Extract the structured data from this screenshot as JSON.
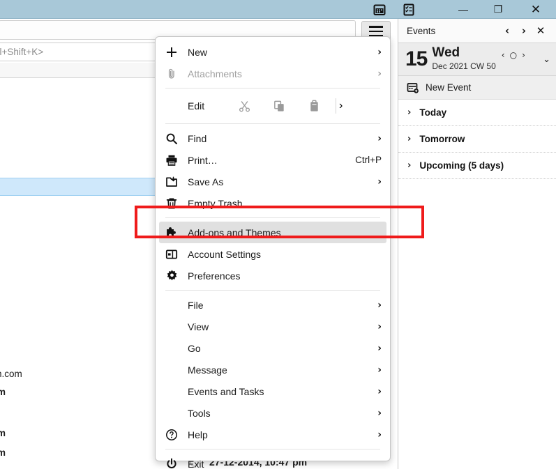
{
  "titlebar": {
    "tabs": [
      {
        "name": "calendar-tab",
        "icon": "calendar-icon"
      },
      {
        "name": "tasks-tab",
        "icon": "tasks-icon"
      }
    ],
    "window_controls": {
      "minimize": "—",
      "restore": "❐",
      "close": "✕"
    },
    "color": "#a8c8d8"
  },
  "mail_pane": {
    "quick_filter_placeholder": "rl+Shift+K>",
    "visible_texts": [
      {
        "text": "@paytm.com",
        "bold": false
      },
      {
        "text": "m",
        "bold": true
      },
      {
        "text": "m",
        "bold": true
      },
      {
        "text": "m",
        "bold": true
      }
    ],
    "ghost_row_text": "27-12-2014, 10:47 pm"
  },
  "hamburger": {
    "name": "app-menu-button",
    "label": "Application Menu"
  },
  "appmenu": {
    "items": [
      {
        "label": "New",
        "icon": "plus-icon",
        "chevron": "›",
        "dim": false,
        "shortcut": ""
      },
      {
        "label": "Attachments",
        "icon": "paperclip-icon",
        "chevron": "›",
        "dim": true,
        "shortcut": ""
      }
    ],
    "edit_row": {
      "label": "Edit",
      "cut": "cut-icon",
      "copy": "copy-icon",
      "paste": "paste-icon",
      "chevron": "›"
    },
    "items2": [
      {
        "label": "Find",
        "icon": "search-icon",
        "chevron": "›",
        "shortcut": ""
      },
      {
        "label": "Print…",
        "icon": "printer-icon",
        "chevron": "",
        "shortcut": "Ctrl+P"
      },
      {
        "label": "Save As",
        "icon": "save-as-icon",
        "chevron": "›",
        "shortcut": ""
      },
      {
        "label": "Empty Trash",
        "icon": "trash-icon",
        "chevron": "",
        "shortcut": ""
      }
    ],
    "items3": [
      {
        "label": "Add-ons and Themes",
        "icon": "puzzle-icon",
        "chevron": "",
        "shortcut": "",
        "highlighted": true
      },
      {
        "label": "Account Settings",
        "icon": "account-icon",
        "chevron": "",
        "shortcut": "",
        "highlighted": false
      },
      {
        "label": "Preferences",
        "icon": "gear-icon",
        "chevron": "",
        "shortcut": "",
        "highlighted": false
      }
    ],
    "items4": [
      {
        "label": "File",
        "icon": "",
        "chevron": "›"
      },
      {
        "label": "View",
        "icon": "",
        "chevron": "›"
      },
      {
        "label": "Go",
        "icon": "",
        "chevron": "›"
      },
      {
        "label": "Message",
        "icon": "",
        "chevron": "›"
      },
      {
        "label": "Events and Tasks",
        "icon": "",
        "chevron": "›"
      },
      {
        "label": "Tools",
        "icon": "",
        "chevron": "›"
      },
      {
        "label": "Help",
        "icon": "help-icon",
        "chevron": "›"
      }
    ],
    "items5": [
      {
        "label": "Exit",
        "icon": "power-icon",
        "chevron": ""
      }
    ]
  },
  "annotation": {
    "name": "red-highlight-box",
    "color": "#ef1b1b",
    "target": "Add-ons and Themes"
  },
  "events_panel": {
    "title": "Events",
    "nav_prev": "‹",
    "nav_next": "›",
    "close": "✕",
    "date": {
      "day": "15",
      "weekday": "Wed",
      "subline": "Dec 2021  CW 50",
      "mini_prev": "‹",
      "mini_today": "○",
      "mini_next": "›",
      "caret": "⌄"
    },
    "new_event": "New Event",
    "groups": [
      {
        "label": "Today",
        "twisty": "›"
      },
      {
        "label": "Tomorrow",
        "twisty": "›"
      },
      {
        "label": "Upcoming (5 days)",
        "twisty": "›"
      }
    ]
  }
}
